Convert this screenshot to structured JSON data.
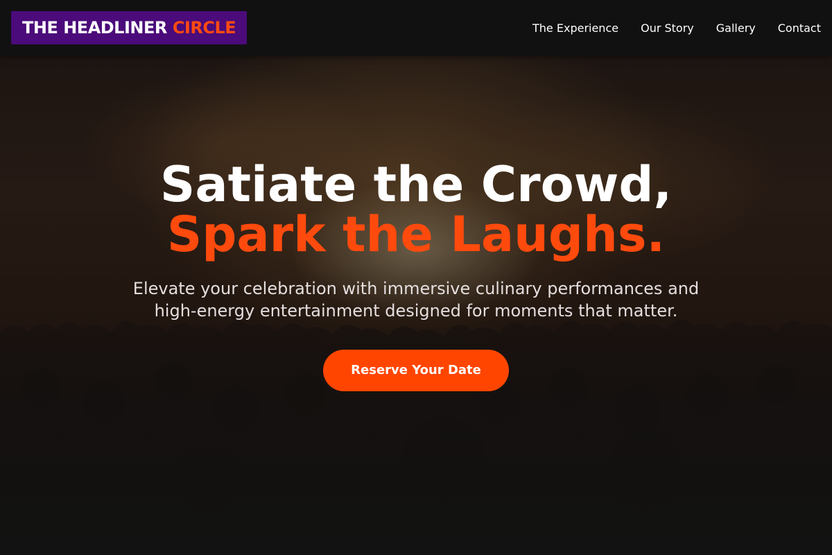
{
  "header": {
    "logo": {
      "part1": "THE HEADLINER",
      "part2": "CIRCLE"
    },
    "nav": [
      {
        "label": "The Experience"
      },
      {
        "label": "Our Story"
      },
      {
        "label": "Gallery"
      },
      {
        "label": "Contact"
      }
    ]
  },
  "hero": {
    "headline_line1": "Satiate the Crowd,",
    "headline_line2": "Spark the Laughs.",
    "subheadline": "Elevate your celebration with immersive culinary performances and high-energy entertainment designed for moments that matter.",
    "cta_label": "Reserve Your Date"
  },
  "colors": {
    "header_bg": "#111111",
    "logo_bg": "#4b0b7a",
    "accent": "#ff4500",
    "text": "#ffffff"
  }
}
